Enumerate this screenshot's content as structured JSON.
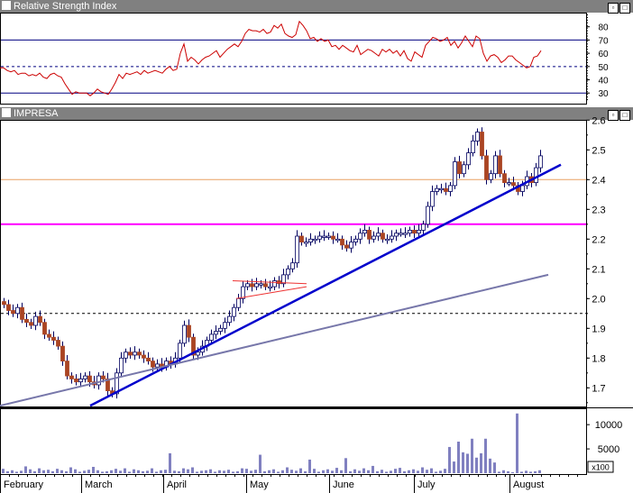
{
  "rsi_panel": {
    "title": "Relative Strength Index"
  },
  "price_panel": {
    "title": "IMPRESA"
  },
  "volume_panel": {
    "unit_label": "x100"
  },
  "window_buttons": {
    "minimize": "▫",
    "maximize": "□"
  },
  "chart_data": [
    {
      "type": "line",
      "title": "Relative Strength Index",
      "ylim": [
        22,
        90
      ],
      "yticks": [
        "30",
        "40",
        "50",
        "60",
        "70",
        "80"
      ],
      "reference_lines": [
        30,
        50,
        70
      ],
      "colors": {
        "line": "#cc0000",
        "ref_solid": "#000080",
        "ref_dashed": "#000080"
      },
      "x": [
        0,
        4,
        8,
        12,
        16,
        20,
        24,
        28,
        32,
        36,
        40,
        44,
        48,
        52,
        56,
        60,
        64,
        68,
        72,
        76,
        80,
        84,
        88,
        92,
        96,
        100,
        104,
        108,
        112,
        116,
        120,
        124,
        128,
        132,
        136,
        140,
        144,
        148,
        152,
        156,
        160,
        164,
        168,
        172,
        176,
        180,
        184,
        188,
        192,
        196,
        200,
        204,
        208,
        212,
        216,
        220,
        224,
        228,
        232,
        236,
        240,
        244,
        248,
        252,
        256,
        260,
        264,
        268,
        272,
        276,
        280,
        284,
        288,
        292,
        296,
        300,
        304,
        308,
        312,
        316,
        320,
        324,
        328,
        332,
        336,
        340,
        344,
        348,
        352,
        356,
        360,
        364,
        368,
        372,
        376,
        380,
        384,
        388,
        392,
        396,
        400,
        404,
        408,
        412,
        416,
        420,
        424,
        428,
        432,
        436,
        440,
        444,
        448,
        452,
        456,
        460,
        464,
        468,
        472,
        476,
        480,
        484,
        488,
        492,
        496,
        500,
        504,
        508,
        512,
        516,
        520,
        524,
        528,
        532,
        536,
        540,
        544,
        548,
        552,
        556,
        560,
        564,
        568,
        572,
        576,
        580,
        584,
        588,
        592,
        596,
        600
      ],
      "y": [
        49,
        49,
        47,
        46,
        47,
        44,
        45,
        45,
        43,
        44,
        43,
        45,
        42,
        41,
        44,
        45,
        43,
        42,
        37,
        33,
        29,
        31,
        30,
        30,
        30,
        28,
        30,
        33,
        31,
        30,
        29,
        33,
        38,
        44,
        41,
        45,
        44,
        45,
        46,
        44,
        47,
        45,
        46,
        47,
        46,
        45,
        48,
        50,
        47,
        48,
        60,
        67,
        54,
        57,
        55,
        52,
        55,
        57,
        58,
        60,
        62,
        57,
        60,
        63,
        65,
        67,
        65,
        69,
        75,
        78,
        77,
        77,
        76,
        78,
        75,
        76,
        81,
        79,
        82,
        75,
        73,
        72,
        74,
        84,
        81,
        77,
        71,
        72,
        69,
        71,
        69,
        70,
        65,
        66,
        63,
        66,
        64,
        62,
        61,
        66,
        59,
        61,
        63,
        62,
        60,
        58,
        63,
        61,
        63,
        60,
        62,
        58,
        62,
        56,
        54,
        61,
        59,
        57,
        66,
        69,
        72,
        71,
        69,
        70,
        72,
        66,
        69,
        64,
        68,
        73,
        69,
        65,
        73,
        71,
        60,
        54,
        58,
        59,
        57,
        53,
        55,
        58,
        58,
        55,
        53,
        51,
        49,
        50,
        57,
        58,
        62
      ]
    },
    {
      "type": "candlestick",
      "title": "IMPRESA",
      "ylim": [
        1.6,
        2.65
      ],
      "yticks": [
        "1.7",
        "1.8",
        "1.9",
        "2.0",
        "2.1",
        "2.2",
        "2.3",
        "2.4",
        "2.5",
        "2.6"
      ],
      "categories": [
        "February",
        "March",
        "April",
        "May",
        "June",
        "July",
        "August"
      ],
      "horizontal_lines": [
        {
          "value": 2.4,
          "color": "#e8a060",
          "style": "solid"
        },
        {
          "value": 2.25,
          "color": "#ff00ff",
          "style": "solid"
        },
        {
          "value": 1.95,
          "color": "#000000",
          "style": "dashed"
        }
      ],
      "trendlines": [
        {
          "from": [
            100,
            1.64
          ],
          "to": [
            622,
            2.45
          ],
          "color": "#0000cc"
        },
        {
          "from": [
            0,
            1.64
          ],
          "to": [
            608,
            2.08
          ],
          "color": "#7777aa"
        },
        {
          "from": [
            258,
            2.06
          ],
          "to": [
            340,
            2.05
          ],
          "color": "#ee3333"
        },
        {
          "from": [
            262,
            2.0
          ],
          "to": [
            340,
            2.04
          ],
          "color": "#ee3333"
        }
      ],
      "colors": {
        "up": "#ffffff",
        "down": "#aa4422",
        "outline": "#000060",
        "wick": "#000060"
      },
      "x": [
        4,
        9,
        14,
        19,
        24,
        29,
        34,
        39,
        44,
        49,
        54,
        59,
        64,
        69,
        74,
        79,
        84,
        89,
        94,
        99,
        104,
        109,
        114,
        119,
        124,
        129,
        134,
        139,
        144,
        149,
        154,
        159,
        164,
        169,
        174,
        179,
        184,
        189,
        194,
        199,
        204,
        209,
        214,
        219,
        224,
        229,
        234,
        239,
        244,
        249,
        254,
        259,
        264,
        269,
        274,
        279,
        284,
        289,
        294,
        299,
        304,
        309,
        314,
        319,
        324,
        329,
        334,
        339,
        344,
        349,
        354,
        359,
        364,
        369,
        374,
        379,
        384,
        389,
        394,
        399,
        404,
        409,
        414,
        419,
        424,
        429,
        434,
        439,
        444,
        449,
        454,
        459,
        464,
        469,
        474,
        479,
        484,
        489,
        494,
        499,
        504,
        509,
        514,
        519,
        524,
        529,
        534,
        539,
        544,
        549,
        554,
        559,
        564,
        569,
        574,
        579,
        584,
        589,
        594,
        599
      ],
      "values": [
        1.98,
        1.96,
        1.95,
        1.97,
        1.93,
        1.92,
        1.91,
        1.94,
        1.92,
        1.88,
        1.87,
        1.86,
        1.84,
        1.79,
        1.74,
        1.73,
        1.72,
        1.73,
        1.74,
        1.72,
        1.71,
        1.74,
        1.73,
        1.69,
        1.68,
        1.75,
        1.8,
        1.82,
        1.81,
        1.82,
        1.81,
        1.8,
        1.79,
        1.77,
        1.78,
        1.77,
        1.79,
        1.78,
        1.8,
        1.85,
        1.91,
        1.87,
        1.81,
        1.82,
        1.84,
        1.86,
        1.88,
        1.89,
        1.9,
        1.92,
        1.94,
        1.97,
        2.0,
        2.04,
        2.05,
        2.04,
        2.05,
        2.05,
        2.04,
        2.04,
        2.06,
        2.05,
        2.08,
        2.1,
        2.12,
        2.21,
        2.19,
        2.19,
        2.2,
        2.2,
        2.21,
        2.21,
        2.21,
        2.2,
        2.2,
        2.18,
        2.17,
        2.19,
        2.2,
        2.22,
        2.23,
        2.2,
        2.21,
        2.22,
        2.2,
        2.2,
        2.21,
        2.22,
        2.22,
        2.22,
        2.23,
        2.22,
        2.23,
        2.25,
        2.31,
        2.36,
        2.37,
        2.37,
        2.36,
        2.38,
        2.46,
        2.42,
        2.45,
        2.49,
        2.53,
        2.56,
        2.48,
        2.4,
        2.42,
        2.48,
        2.42,
        2.39,
        2.39,
        2.38,
        2.36,
        2.38,
        2.41,
        2.39,
        2.44,
        2.48
      ]
    },
    {
      "type": "bar",
      "title": "",
      "ylim": [
        0,
        13000
      ],
      "yticks": [
        "5000",
        "10000"
      ],
      "colors": {
        "bar": "#8080c0"
      },
      "x": [
        3,
        8,
        13,
        18,
        23,
        28,
        33,
        38,
        43,
        48,
        53,
        58,
        63,
        68,
        73,
        78,
        83,
        88,
        93,
        98,
        103,
        108,
        113,
        118,
        123,
        128,
        133,
        138,
        143,
        148,
        153,
        158,
        163,
        168,
        173,
        178,
        183,
        188,
        193,
        198,
        203,
        208,
        213,
        218,
        223,
        228,
        233,
        238,
        243,
        248,
        253,
        258,
        263,
        268,
        273,
        278,
        283,
        288,
        293,
        298,
        303,
        308,
        313,
        318,
        323,
        328,
        333,
        338,
        343,
        348,
        353,
        358,
        363,
        368,
        373,
        378,
        383,
        388,
        393,
        398,
        403,
        408,
        413,
        418,
        423,
        428,
        433,
        438,
        443,
        448,
        453,
        458,
        463,
        468,
        473,
        478,
        483,
        488,
        493,
        498,
        503,
        508,
        513,
        518,
        523,
        528,
        533,
        538,
        543,
        548,
        553,
        558,
        563,
        568,
        573,
        578,
        583,
        588,
        593,
        598
      ],
      "values": [
        900,
        400,
        600,
        300,
        500,
        1400,
        800,
        400,
        1000,
        600,
        700,
        400,
        900,
        600,
        400,
        1200,
        800,
        300,
        500,
        700,
        1300,
        600,
        300,
        400,
        600,
        900,
        500,
        1000,
        300,
        800,
        600,
        400,
        500,
        1000,
        300,
        600,
        700,
        4100,
        500,
        400,
        1000,
        800,
        1200,
        300,
        500,
        600,
        800,
        300,
        600,
        500,
        700,
        300,
        400,
        1000,
        900,
        500,
        700,
        3800,
        400,
        600,
        800,
        300,
        600,
        1200,
        700,
        500,
        1000,
        400,
        2800,
        900,
        300,
        600,
        800,
        500,
        1100,
        600,
        3100,
        400,
        800,
        500,
        1000,
        600,
        1500,
        400,
        700,
        300,
        500,
        900,
        1100,
        400,
        600,
        800,
        500,
        1200,
        700,
        1000,
        300,
        500,
        900,
        5400,
        2400,
        6500,
        4300,
        4000,
        7100,
        3200,
        4100,
        7100,
        3000,
        2200,
        300,
        600,
        400,
        200,
        12300,
        300,
        500,
        300,
        400,
        600
      ]
    }
  ],
  "x_axis": {
    "labels": [
      "February",
      "March",
      "April",
      "May",
      "June",
      "July",
      "August"
    ]
  }
}
